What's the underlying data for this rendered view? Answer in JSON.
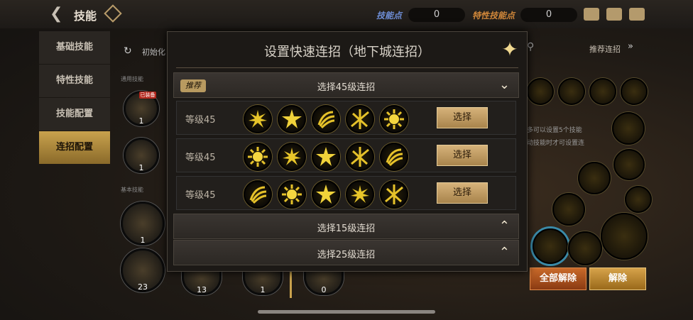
{
  "header": {
    "title": "技能",
    "skill_points_label": "技能点",
    "skill_points_value": "0",
    "trait_points_label": "特性技能点",
    "trait_points_value": "0"
  },
  "sidebar": {
    "items": [
      {
        "label": "基础技能"
      },
      {
        "label": "特性技能"
      },
      {
        "label": "技能配置"
      },
      {
        "label": "连招配置"
      }
    ]
  },
  "left_panel": {
    "reset_label": "初始化",
    "general_label": "通用技能",
    "basic_label": "基本技能",
    "badge_text": "已装备",
    "counts": [
      "1",
      "1",
      "1",
      "23",
      "13",
      "1",
      "0"
    ]
  },
  "right_panel": {
    "recommend_label": "推荐连招",
    "desc_line1": "多可以设置5个技能",
    "desc_line2": "动技能时才可设置连",
    "clear_all": "全部解除",
    "clear": "解除"
  },
  "modal": {
    "title": "设置快速连招（地下城连招）",
    "sections": [
      {
        "badge": "推荐",
        "label": "选择45级连招",
        "expanded": true
      },
      {
        "label": "选择15级连招",
        "expanded": false
      },
      {
        "label": "选择25级连招",
        "expanded": false
      }
    ],
    "rows": [
      {
        "level": "等级45",
        "select": "选择"
      },
      {
        "level": "等级45",
        "select": "选择"
      },
      {
        "level": "等级45",
        "select": "选择"
      }
    ]
  },
  "colors": {
    "accent": "#c9a24d",
    "button": "#c6a270"
  }
}
